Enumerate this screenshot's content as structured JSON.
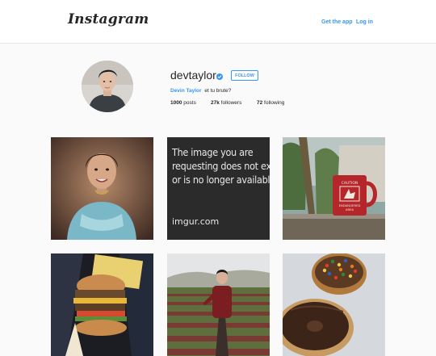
{
  "header": {
    "logo": "Instagram",
    "links": [
      "Get the app",
      "Log in"
    ]
  },
  "profile": {
    "username": "devtaylor",
    "verified_icon": "verified-badge-icon",
    "follow_label": "FOLLOW",
    "full_name": "Devin Taylor",
    "bio": "et tu brute?",
    "stats": [
      {
        "count": "1000",
        "label": "posts"
      },
      {
        "count": "27k",
        "label": "followers"
      },
      {
        "count": "72",
        "label": "following"
      }
    ]
  },
  "posts": {
    "imgur_lines": [
      "The image you are",
      "requesting does not exist",
      "or is no longer available."
    ],
    "imgur_domain": "imgur.com",
    "mug_text": [
      "CAUTION",
      "ENDANGERED",
      "AREA"
    ]
  },
  "colors": {
    "accent": "#3897f0",
    "background": "#fafafa"
  }
}
